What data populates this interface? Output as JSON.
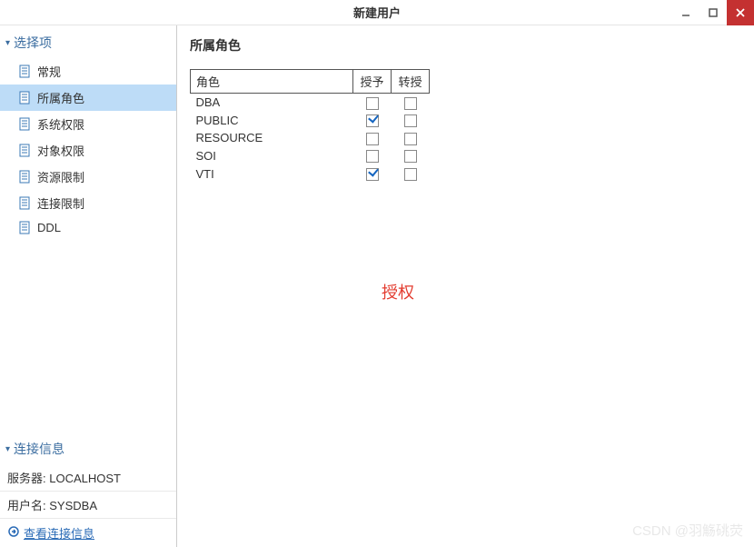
{
  "window": {
    "title": "新建用户"
  },
  "sidebar": {
    "section_title": "选择项",
    "items": [
      {
        "label": "常规"
      },
      {
        "label": "所属角色"
      },
      {
        "label": "系统权限"
      },
      {
        "label": "对象权限"
      },
      {
        "label": "资源限制"
      },
      {
        "label": "连接限制"
      },
      {
        "label": "DDL"
      }
    ],
    "conn_section_title": "连接信息",
    "server_label": "服务器:",
    "server_value": "LOCALHOST",
    "user_label": "用户名:",
    "user_value": "SYSDBA",
    "view_link": "查看连接信息"
  },
  "content": {
    "heading": "所属角色",
    "columns": {
      "role": "角色",
      "grant": "授予",
      "transfer": "转授"
    },
    "rows": [
      {
        "name": "DBA",
        "grant": false,
        "transfer": false
      },
      {
        "name": "PUBLIC",
        "grant": true,
        "transfer": false
      },
      {
        "name": "RESOURCE",
        "grant": false,
        "transfer": false
      },
      {
        "name": "SOI",
        "grant": false,
        "transfer": false
      },
      {
        "name": "VTI",
        "grant": true,
        "transfer": false
      }
    ],
    "annotation": "授权"
  },
  "watermark": "CSDN @羽觞䂪荧"
}
